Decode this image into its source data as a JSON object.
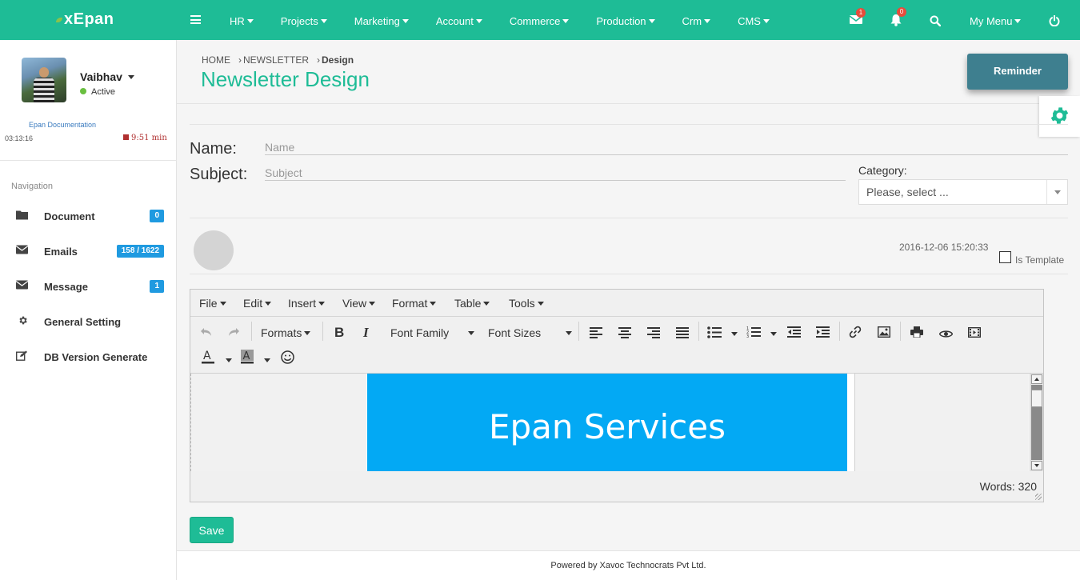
{
  "app": {
    "logo": "xEpan"
  },
  "topnav": [
    {
      "label": "HR"
    },
    {
      "label": "Projects"
    },
    {
      "label": "Marketing"
    },
    {
      "label": "Account"
    },
    {
      "label": "Commerce"
    },
    {
      "label": "Production"
    },
    {
      "label": "Crm"
    },
    {
      "label": "CMS"
    }
  ],
  "top_icons": {
    "mail_badge": "1",
    "bell_badge": "0",
    "my_menu": "My Menu"
  },
  "user": {
    "name": "Vaibhav",
    "status": "Active",
    "doc_link": "Epan Documentation",
    "time_elapsed": "03:13:16",
    "time_remaining": "9:51 min"
  },
  "sidebar": {
    "title": "Navigation",
    "items": [
      {
        "label": "Document",
        "count": "0",
        "icon": "folder-icon"
      },
      {
        "label": "Emails",
        "count": "158 / 1622",
        "icon": "envelope-icon"
      },
      {
        "label": "Message",
        "count": "1",
        "icon": "envelope-icon"
      },
      {
        "label": "General Setting",
        "count": null,
        "icon": "gear-icon"
      },
      {
        "label": "DB Version Generate",
        "count": null,
        "icon": "edit-icon"
      }
    ]
  },
  "breadcrumb": {
    "home": "HOME",
    "section": "NEWSLETTER",
    "current": "Design"
  },
  "page": {
    "title": "Newsletter Design",
    "reminder": "Reminder"
  },
  "form": {
    "name_label": "Name:",
    "name_placeholder": "Name",
    "subject_label": "Subject:",
    "subject_placeholder": "Subject",
    "category_label": "Category:",
    "category_value": "Please, select ...",
    "datetime": "2016-12-06 15:20:33",
    "is_template_label": "Is Template"
  },
  "editor": {
    "menus": [
      "File",
      "Edit",
      "Insert",
      "View",
      "Format",
      "Table",
      "Tools"
    ],
    "formats": "Formats",
    "font_family": "Font Family",
    "font_sizes": "Font Sizes",
    "banner_text": "Epan Services",
    "banner_color": "#03a9f4",
    "word_count": "Words: 320"
  },
  "actions": {
    "save": "Save"
  },
  "footer": {
    "text": "Powered by Xavoc Technocrats Pvt Ltd."
  },
  "colors": {
    "brand": "#1ebc96",
    "badge_blue": "#1f9ae0",
    "badge_red": "#e74c3c"
  }
}
